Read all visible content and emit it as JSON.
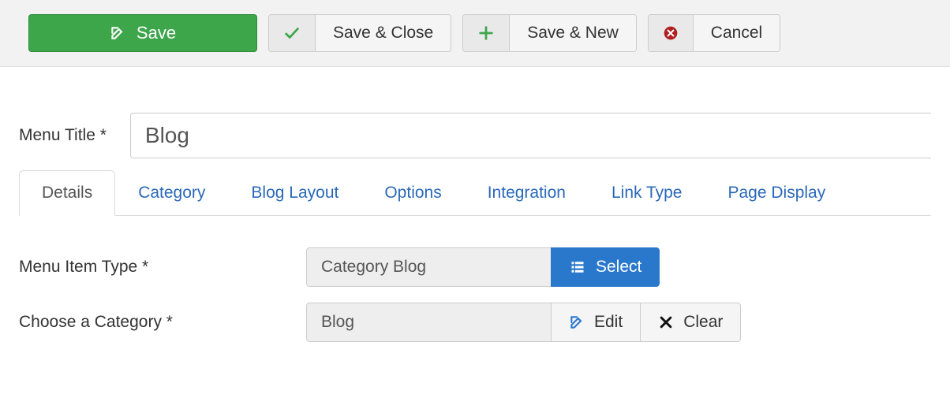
{
  "toolbar": {
    "save": "Save",
    "save_close": "Save & Close",
    "save_new": "Save & New",
    "cancel": "Cancel"
  },
  "form": {
    "menu_title_label": "Menu Title *",
    "menu_title_value": "Blog"
  },
  "tabs": [
    {
      "id": "details",
      "label": "Details",
      "active": true
    },
    {
      "id": "category",
      "label": "Category",
      "active": false
    },
    {
      "id": "blog-layout",
      "label": "Blog Layout",
      "active": false
    },
    {
      "id": "options",
      "label": "Options",
      "active": false
    },
    {
      "id": "integration",
      "label": "Integration",
      "active": false
    },
    {
      "id": "link-type",
      "label": "Link Type",
      "active": false
    },
    {
      "id": "page-display",
      "label": "Page Display",
      "active": false
    }
  ],
  "details": {
    "menu_item_type_label": "Menu Item Type *",
    "menu_item_type_value": "Category Blog",
    "select_label": "Select",
    "choose_category_label": "Choose a Category *",
    "choose_category_value": "Blog",
    "edit_label": "Edit",
    "clear_label": "Clear"
  }
}
